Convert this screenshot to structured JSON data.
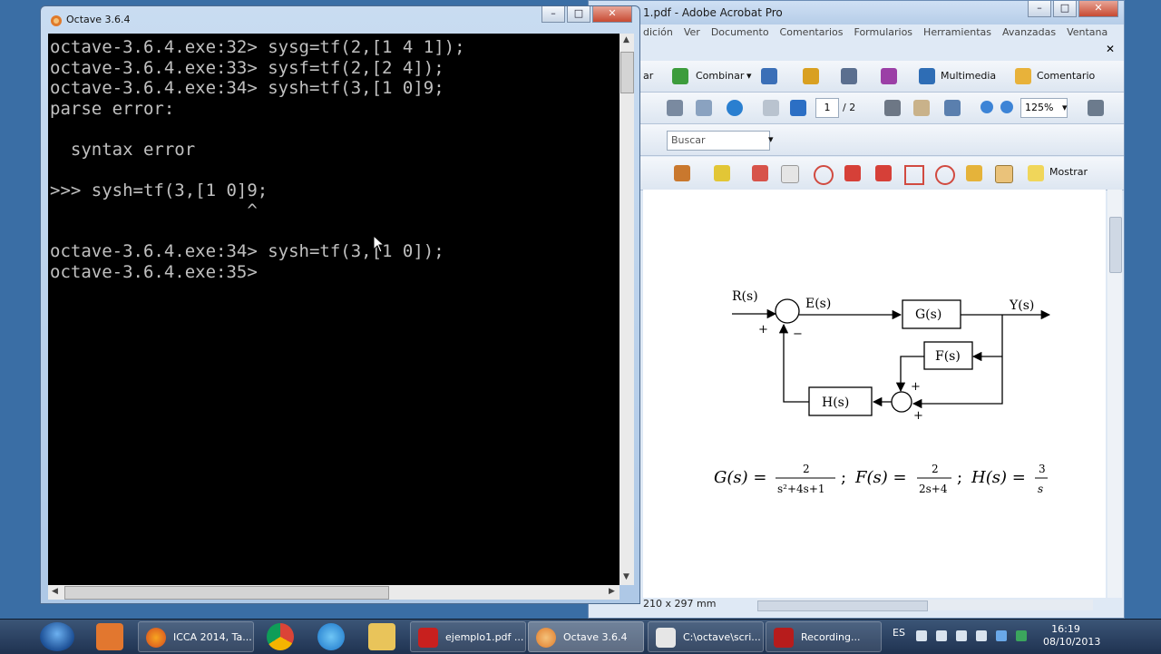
{
  "octave": {
    "title": "Octave 3.6.4",
    "lines": [
      "octave-3.6.4.exe:32> sysg=tf(2,[1 4 1]);",
      "octave-3.6.4.exe:33> sysf=tf(2,[2 4]);",
      "octave-3.6.4.exe:34> sysh=tf(3,[1 0]9;",
      "parse error:",
      "",
      "  syntax error",
      "",
      ">>> sysh=tf(3,[1 0]9;",
      "                   ^",
      "",
      "octave-3.6.4.exe:34> sysh=tf(3,[1 0]);",
      "octave-3.6.4.exe:35> "
    ]
  },
  "acrobat": {
    "title": "1.pdf - Adobe Acrobat Pro",
    "menu": [
      "dición",
      "Ver",
      "Documento",
      "Comentarios",
      "Formularios",
      "Herramientas",
      "Avanzadas",
      "Ventana"
    ],
    "toolbar1": {
      "crear_label": "ar",
      "combinar_label": "Combinar",
      "multimedia_label": "Multimedia",
      "comentario_label": "Comentario"
    },
    "toolbar2": {
      "page_current": "1",
      "page_total": "/ 2",
      "zoom": "125%"
    },
    "toolbar3": {
      "search_placeholder": "Buscar"
    },
    "toolbar4": {
      "mostrar_label": "Mostrar"
    },
    "statusbar": {
      "page_size": "210 x 297 mm"
    },
    "diagram": {
      "r_label": "R(s)",
      "e_label": "E(s)",
      "g_label": "G(s)",
      "y_label": "Y(s)",
      "f_label": "F(s)",
      "h_label": "H(s)",
      "plus1": "+",
      "minus1": "−",
      "plus2": "+",
      "plus3": "+"
    },
    "equations": {
      "g_lhs": "G(s) =",
      "g_num": "2",
      "g_den": "s²+4s+1",
      "sep1": ";",
      "f_lhs": "F(s) =",
      "f_num": "2",
      "f_den": "2s+4",
      "sep2": ";",
      "h_lhs": "H(s) =",
      "h_num": "3",
      "h_den": "s"
    }
  },
  "taskbar": {
    "tasks": [
      {
        "label": "ICCA 2014, Ta..."
      },
      {
        "label": "ejemplo1.pdf ..."
      },
      {
        "label": "Octave 3.6.4"
      },
      {
        "label": "C:\\octave\\scri..."
      },
      {
        "label": "Recording..."
      }
    ],
    "language": "ES",
    "time": "16:19",
    "date": "08/10/2013"
  },
  "colors": {
    "console_bg": "#000000",
    "console_text": "#c0c0c0",
    "acrobat_chrome": "#dfe9f5",
    "taskbar": "#1f3250"
  }
}
